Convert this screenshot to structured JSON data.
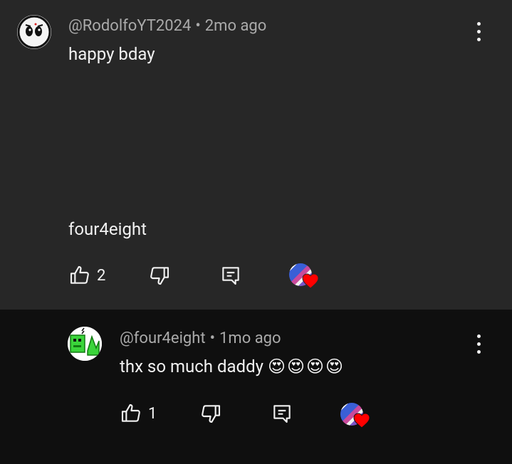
{
  "comments": [
    {
      "author": "@RodolfoYT2024",
      "separator": "•",
      "time": "2mo ago",
      "lines": [
        "happy bday",
        "four4eight"
      ],
      "likes": "2",
      "avatar_icon": "cartoon-face-icon",
      "background": "#272727"
    },
    {
      "author": "@four4eight",
      "separator": "•",
      "time": "1mo ago",
      "text": "thx so much daddy",
      "emojis": "😍😍😍😍",
      "likes": "1",
      "avatar_icon": "green-creature-icon",
      "background": "#0f0f0f"
    }
  ],
  "colors": {
    "text_primary": "#f1f1f1",
    "text_secondary": "#aaaaaa",
    "heart": "#ff0000"
  },
  "icons": [
    "like-icon",
    "dislike-icon",
    "reply-icon",
    "more-options-icon",
    "creator-heart-icon"
  ]
}
